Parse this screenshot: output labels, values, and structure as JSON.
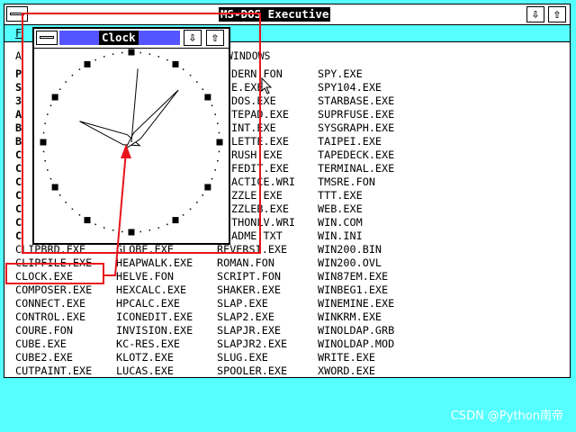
{
  "exec": {
    "title": "MS-DOS Executive",
    "title_partial": "MS-DOS Executive",
    "menu_first": "F",
    "drive_label": "A",
    "path": "WINDOWS",
    "btn_minimize": "⇩",
    "btn_maximize": "⇧"
  },
  "clock": {
    "title": "Clock",
    "btn_minimize": "⇩",
    "btn_maximize": "⇧",
    "hour_hand_angle_deg": 292,
    "minute_hand_angle_deg": 42,
    "second_hand_angle_deg": 5
  },
  "files": {
    "col1": [
      "CLIPBRD.EXE",
      "CLIPFILE.EXE",
      "CLOCK.EXE",
      "COMPOSER.EXE",
      "CONNECT.EXE",
      "CONTROL.EXE",
      "COURE.FON",
      "CUBE.EXE",
      "CUBE2.EXE",
      "CUTPAINT.EXE"
    ],
    "col2": [
      "GLOBE.EXE",
      "HEAPWALK.EXE",
      "HELVE.FON",
      "HEXCALC.EXE",
      "HPCALC.EXE",
      "ICONEDIT.EXE",
      "INVISION.EXE",
      "KC-RES.EXE",
      "KLOTZ.EXE",
      "LUCAS.EXE"
    ],
    "col3": [
      "DERN.FON",
      "E.EXE",
      "DOS.EXE",
      "TEPAD.EXE",
      "INT.EXE",
      "LETTE.EXE",
      "RUSH.EXE",
      "FEDIT.EXE",
      "ACTICE.WRI",
      "ZZLE.EXE",
      "ZZLEB.EXE",
      "THONLV.WRI",
      "ADME.TXT",
      "REVERSI.EXE",
      "ROMAN.FON",
      "SCRIPT.FON",
      "SHAKER.EXE",
      "SLAP.EXE",
      "SLAP2.EXE",
      "SLAPJR.EXE",
      "SLAPJR2.EXE",
      "SLUG.EXE",
      "SPOOLER.EXE"
    ],
    "col4": [
      "SPY.EXE",
      "SPY104.EXE",
      "STARBASE.EXE",
      "SUPRFUSE.EXE",
      "SYSGRAPH.EXE",
      "TAIPEI.EXE",
      "TAPEDECK.EXE",
      "TERMINAL.EXE",
      "TMSRE.FON",
      "TTT.EXE",
      "WEB.EXE",
      "WIN.COM",
      "WIN.INI",
      "WIN200.BIN",
      "WIN200.OVL",
      "WIN87EM.EXE",
      "WINBEG1.EXE",
      "WINEMINE.EXE",
      "WINKRM.EXE",
      "WINOLDAP.GRB",
      "WINOLDAP.MOD",
      "WRITE.EXE",
      "XWORD.EXE"
    ],
    "col1_partial": [
      "P",
      "S",
      "3",
      "A",
      "B",
      "B",
      "C",
      "C",
      "C",
      "C",
      "C",
      "C",
      "C"
    ]
  },
  "watermark": "CSDN @Python南帝",
  "colors": {
    "desktop": "#55ffff",
    "title_active": "#5555ff",
    "annotation": "#e8141c"
  }
}
